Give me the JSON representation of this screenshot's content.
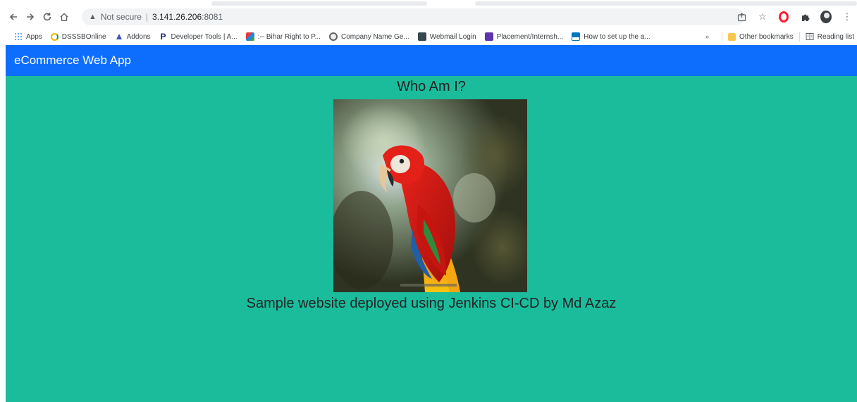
{
  "browser": {
    "address": {
      "security_label": "Not secure",
      "host": "3.141.26.206",
      "port": ":8081"
    },
    "bookmarks": [
      {
        "label": "Apps",
        "icon": "apps-grid-icon",
        "color": "#4285f4"
      },
      {
        "label": "DSSSBOnline",
        "icon": "dsssb-icon",
        "color": "#f4b400"
      },
      {
        "label": "Addons",
        "icon": "addons-icon",
        "color": "#3f51b5"
      },
      {
        "label": "Developer Tools | A...",
        "icon": "p-icon",
        "color": "#1a237e"
      },
      {
        "label": ":-- Bihar Right to P...",
        "icon": "bihar-icon",
        "color": "#e53935"
      },
      {
        "label": "Company Name Ge...",
        "icon": "panda-icon",
        "color": "#9e9e9e"
      },
      {
        "label": "Webmail Login",
        "icon": "webmail-icon",
        "color": "#37474f"
      },
      {
        "label": "Placement/Internsh...",
        "icon": "placement-icon",
        "color": "#5e35b1"
      },
      {
        "label": "How to set up the a...",
        "icon": "howto-icon",
        "color": "#0277bd"
      }
    ],
    "bookmarks_right": {
      "overflow": "»",
      "other_bookmarks": "Other bookmarks",
      "reading_list": "Reading list"
    }
  },
  "app": {
    "brand": "eCommerce Web App",
    "heading": "Who Am I?",
    "caption": "Sample website deployed using Jenkins CI-CD by Md Azaz",
    "colors": {
      "navbar": "#0d6efd",
      "background": "#1abc9c"
    }
  }
}
